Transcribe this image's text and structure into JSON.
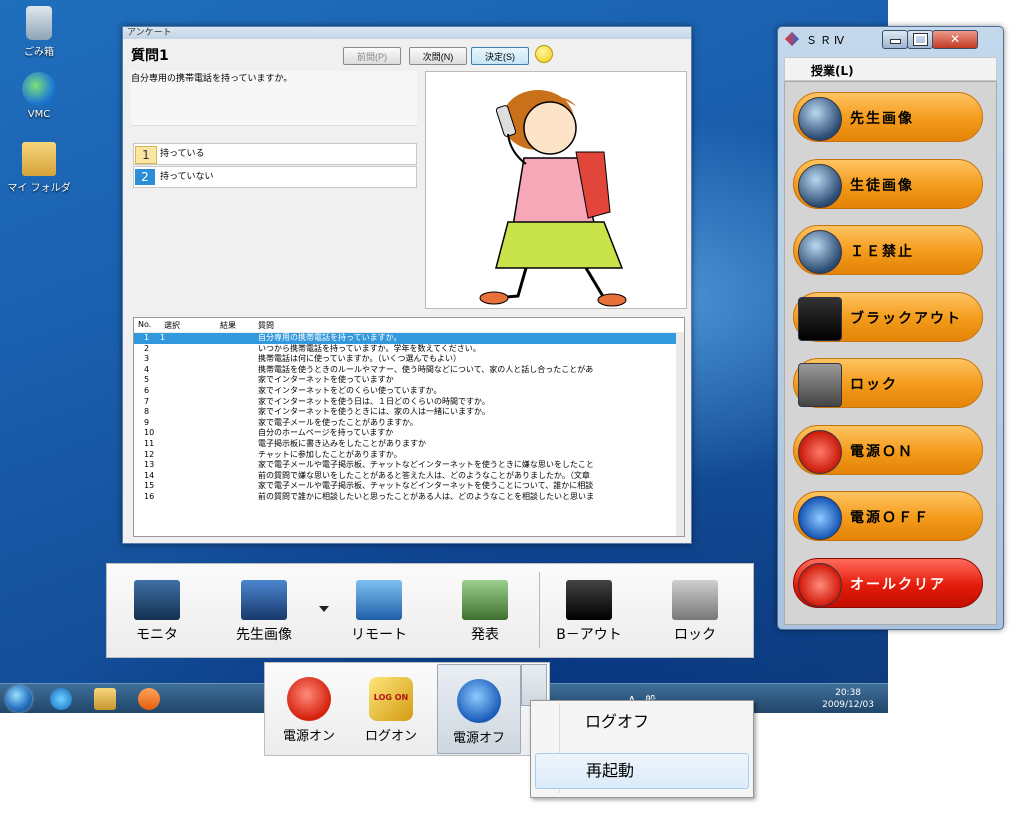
{
  "desktop": {
    "icons": [
      {
        "label": "ごみ箱"
      },
      {
        "label": "VMC"
      },
      {
        "label": "マイ フォルダ"
      }
    ]
  },
  "taskbar": {
    "tray_text": "A 般",
    "clock_time": "20:38",
    "clock_date": "2009/12/03"
  },
  "survey": {
    "window_title": "アンケート",
    "question_title": "質問1",
    "prev_label": "前問(P)",
    "next_label": "次問(N)",
    "ok_label": "決定(S)",
    "question_text": "自分専用の携帯電話を持っていますか。",
    "choices": [
      {
        "num": "1",
        "label": "持っている"
      },
      {
        "num": "2",
        "label": "持っていない"
      }
    ],
    "table": {
      "headers": {
        "no": "No.",
        "select": "選択",
        "result": "結果",
        "question": "質問"
      },
      "rows": [
        {
          "no": "1",
          "select": "1",
          "question": "自分専用の携帯電話を持っていますか。"
        },
        {
          "no": "2",
          "select": "",
          "question": "いつから携帯電話を持っていますか。学年を数えてください。"
        },
        {
          "no": "3",
          "select": "",
          "question": "携帯電話は何に使っていますか。（いくつ選んでもよい）"
        },
        {
          "no": "4",
          "select": "",
          "question": "携帯電話を使うときのルールやマナー、使う時間などについて、家の人と話し合ったことがあ"
        },
        {
          "no": "5",
          "select": "",
          "question": "家でインターネットを使っていますか"
        },
        {
          "no": "6",
          "select": "",
          "question": "家でインターネットをどのくらい使っていますか。"
        },
        {
          "no": "7",
          "select": "",
          "question": "家でインターネットを使う日は、１日どのくらいの時間ですか。"
        },
        {
          "no": "8",
          "select": "",
          "question": "家でインターネットを使うときには、家の人は一緒にいますか。"
        },
        {
          "no": "9",
          "select": "",
          "question": "家で電子メールを使ったことがありますか。"
        },
        {
          "no": "10",
          "select": "",
          "question": "自分のホームページを持っていますか"
        },
        {
          "no": "11",
          "select": "",
          "question": "電子掲示板に書き込みをしたことがありますか"
        },
        {
          "no": "12",
          "select": "",
          "question": "チャットに参加したことがありますか。"
        },
        {
          "no": "13",
          "select": "",
          "question": "家で電子メールや電子掲示板、チャットなどインターネットを使うときに嫌な思いをしたこと"
        },
        {
          "no": "14",
          "select": "",
          "question": "前の質問で嫌な思いをしたことがあると答えた人は、どのようなことがありましたか。（文章"
        },
        {
          "no": "15",
          "select": "",
          "question": "家で電子メールや電子掲示板、チャットなどインターネットを使うことについて、誰かに相談"
        },
        {
          "no": "16",
          "select": "",
          "question": "前の質問で誰かに相談したいと思ったことがある人は、どのようなことを相談したいと思いま"
        }
      ]
    }
  },
  "panel": {
    "title": "ＳＲⅣ",
    "menu_label": "授業(L)",
    "buttons": [
      {
        "id": "teacher-screen",
        "label": "先生画像",
        "icon": "teacher-screen-icon"
      },
      {
        "id": "student-screen",
        "label": "生徒画像",
        "icon": "student-screen-icon"
      },
      {
        "id": "ie-block",
        "label": "ＩＥ禁止",
        "icon": "ie-block-icon"
      },
      {
        "id": "blackout",
        "label": "ブラックアウト",
        "icon": "monitor-black-icon"
      },
      {
        "id": "lock",
        "label": "ロック",
        "icon": "lock-icon"
      },
      {
        "id": "poweron",
        "label": "電源ＯＮ",
        "icon": "power-on-icon"
      },
      {
        "id": "poweroff",
        "label": "電源ＯＦＦ",
        "icon": "power-off-icon"
      },
      {
        "id": "allclear",
        "label": "オールクリア",
        "icon": "all-clear-icon"
      }
    ],
    "accent_color": "#f39a1a",
    "allclear_color": "#e41b0b"
  },
  "toolbar": {
    "monitor_label": "モニタ",
    "teacher_label": "先生画像",
    "remote_label": "リモート",
    "present_label": "発表",
    "blackout_label": "B－アウト",
    "lock_label": "ロック"
  },
  "powerbar": {
    "on_label": "電源オン",
    "logon_label": "ログオン",
    "logon_badge": "LOG ON",
    "off_label": "電源オフ"
  },
  "context_menu": {
    "logoff_label": "ログオフ",
    "restart_label": "再起動"
  }
}
